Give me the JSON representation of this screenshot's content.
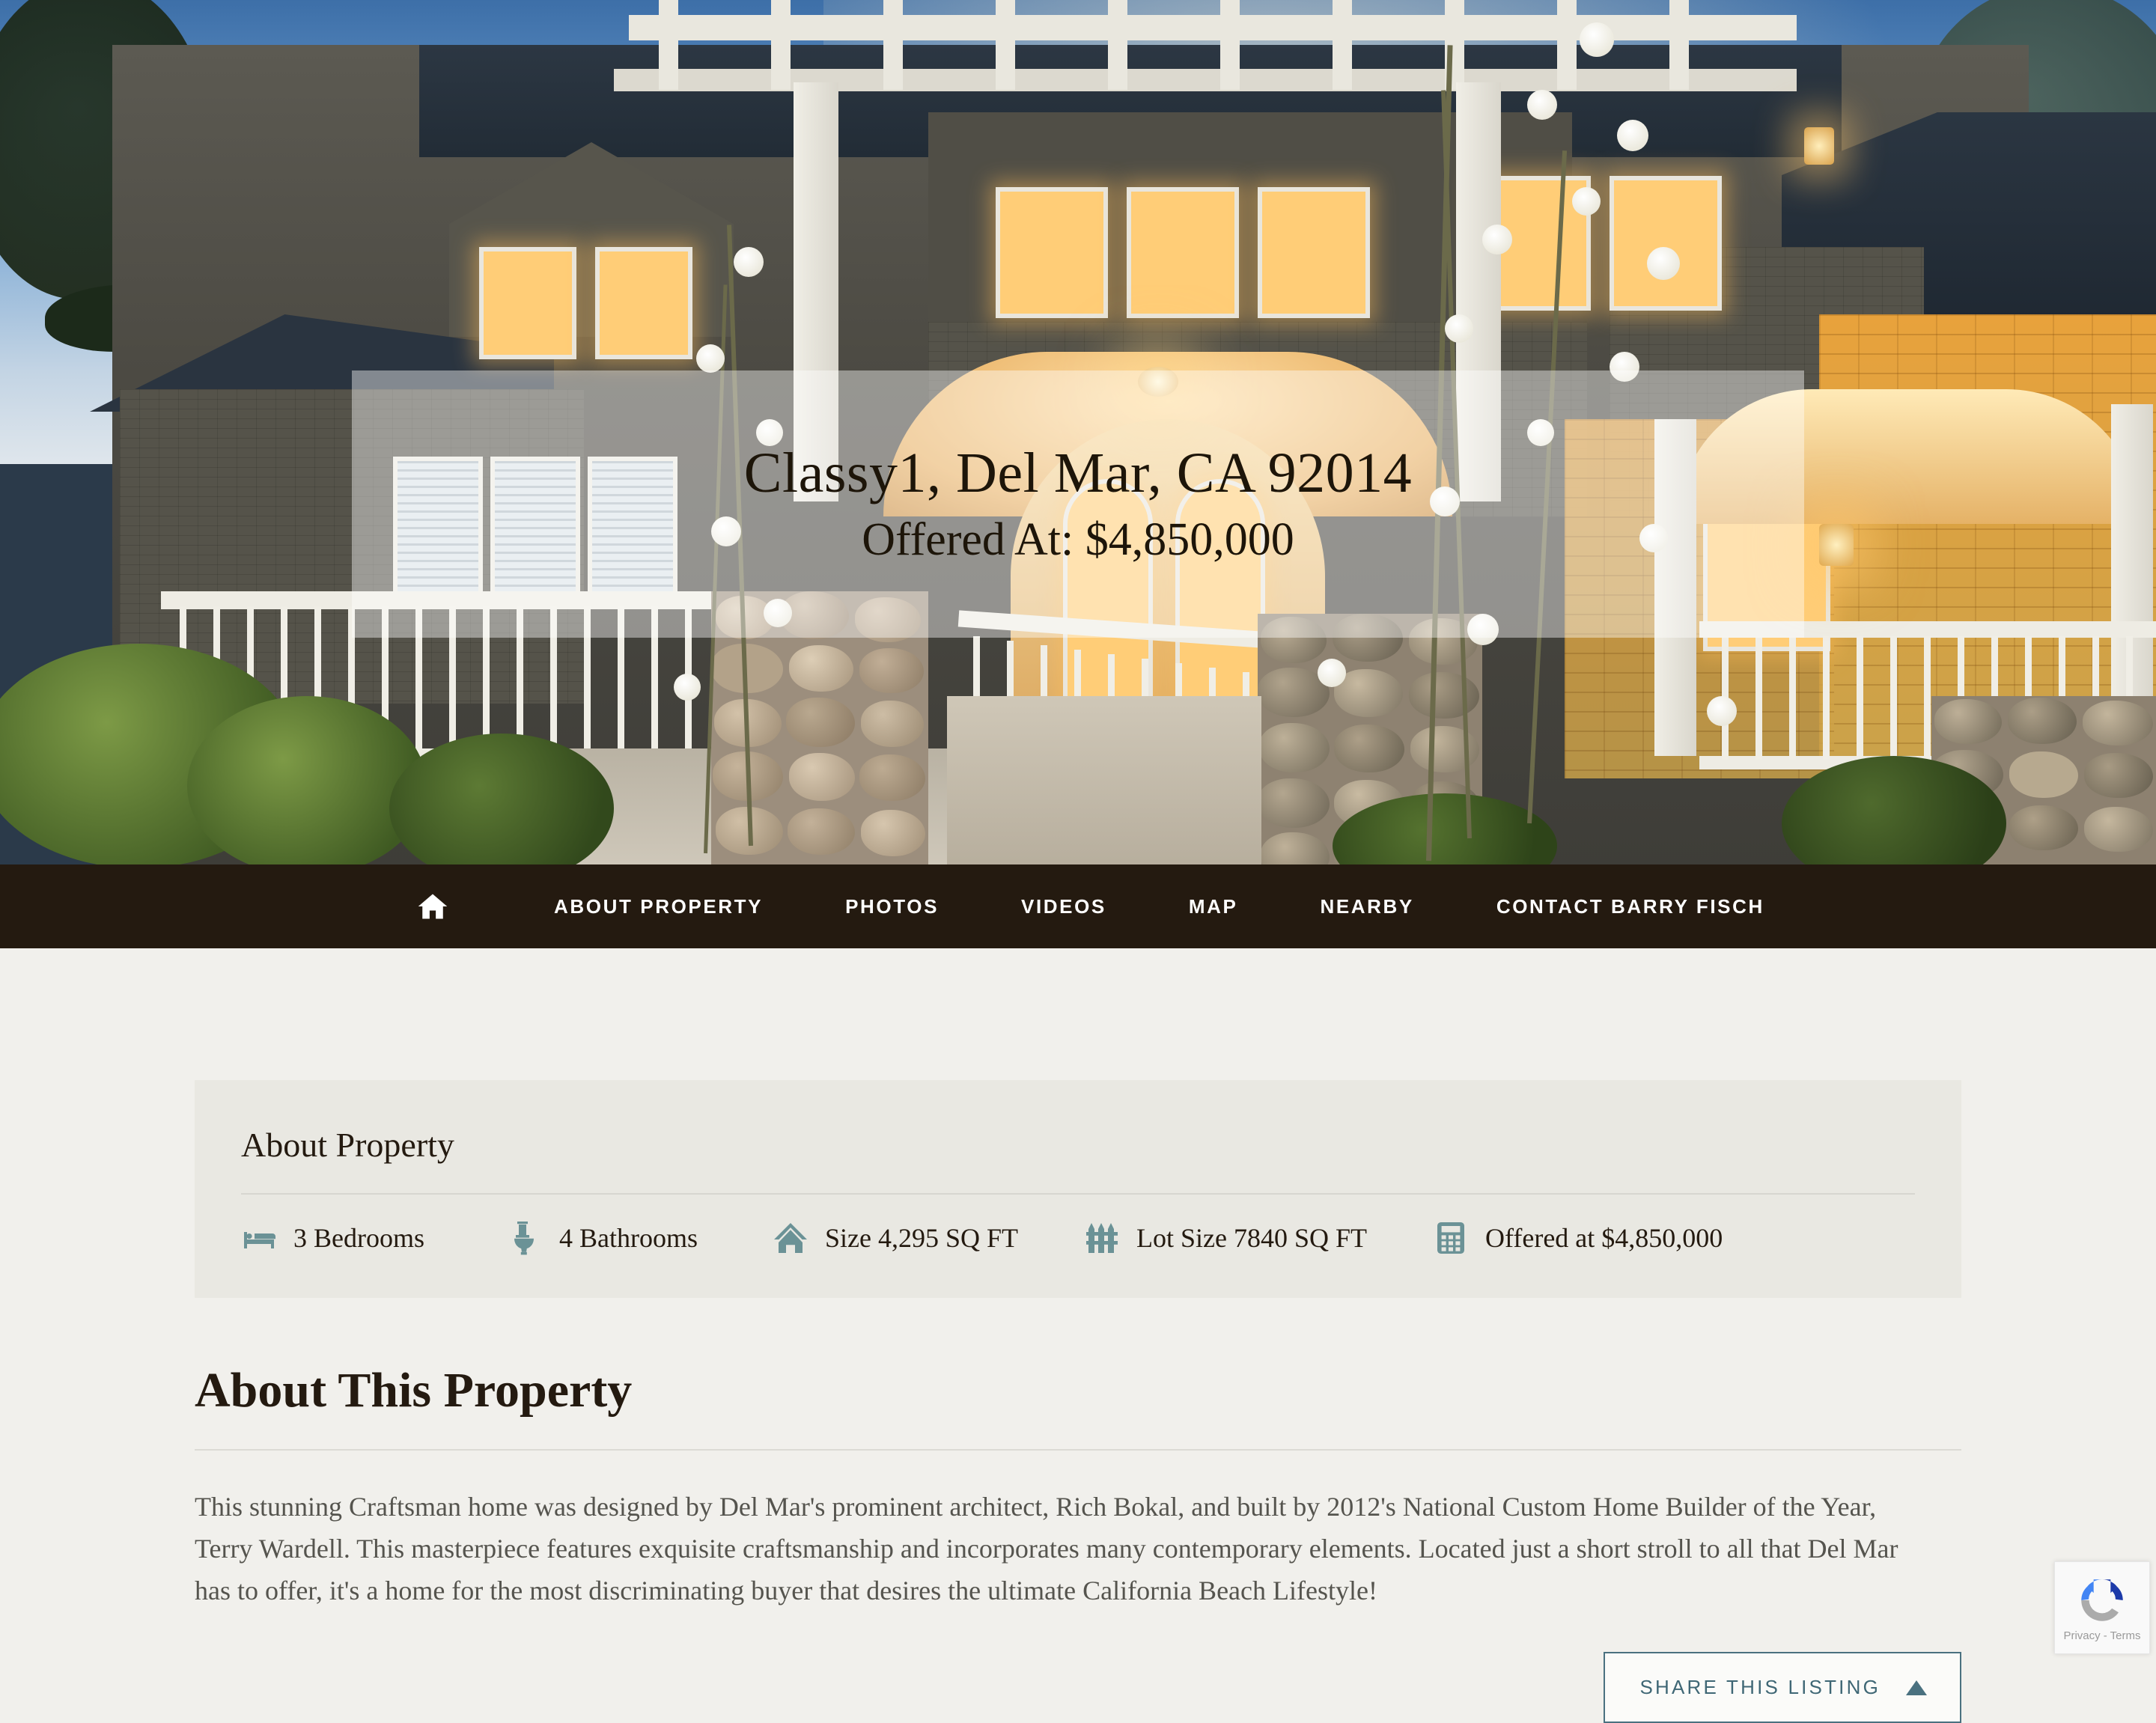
{
  "hero": {
    "title": "Classy1, Del Mar, CA 92014",
    "price": "Offered At: $4,850,000"
  },
  "nav": {
    "home_icon": "home-icon",
    "items": [
      {
        "label": "ABOUT PROPERTY"
      },
      {
        "label": "PHOTOS"
      },
      {
        "label": "VIDEOS"
      },
      {
        "label": "MAP"
      },
      {
        "label": "NEARBY"
      },
      {
        "label": "CONTACT BARRY FISCH"
      }
    ]
  },
  "about_panel": {
    "title": "About Property",
    "features": [
      {
        "icon": "bed-icon",
        "label": "3 Bedrooms"
      },
      {
        "icon": "toilet-icon",
        "label": "4 Bathrooms"
      },
      {
        "icon": "house-icon",
        "label": "Size 4,295 SQ FT"
      },
      {
        "icon": "fence-icon",
        "label": "Lot Size 7840 SQ FT"
      },
      {
        "icon": "calculator-icon",
        "label": "Offered at $4,850,000"
      }
    ]
  },
  "about_section": {
    "title": "About This Property",
    "paragraph": "This stunning Craftsman home was designed by Del Mar's prominent architect, Rich Bokal, and built by 2012's National Custom Home Builder of the Year, Terry Wardell. This masterpiece features exquisite craftsmanship and incorporates many contemporary elements. Located just a short stroll to all that Del Mar has to offer, it's a home for the most discriminating buyer that desires the ultimate California Beach Lifestyle!"
  },
  "share": {
    "label": "SHARE THIS LISTING",
    "caret_icon": "triangle-up-icon"
  },
  "recaptcha": {
    "text": "Privacy - Terms",
    "logo_icon": "recaptcha-icon"
  },
  "colors": {
    "nav_bg": "#241a10",
    "page_bg": "#f1f0ec",
    "panel_bg": "#e9e8e2",
    "accent_teal": "#6b9296",
    "share_border": "#4a7180",
    "text_dark": "#241a10",
    "body_text": "#55544e"
  }
}
